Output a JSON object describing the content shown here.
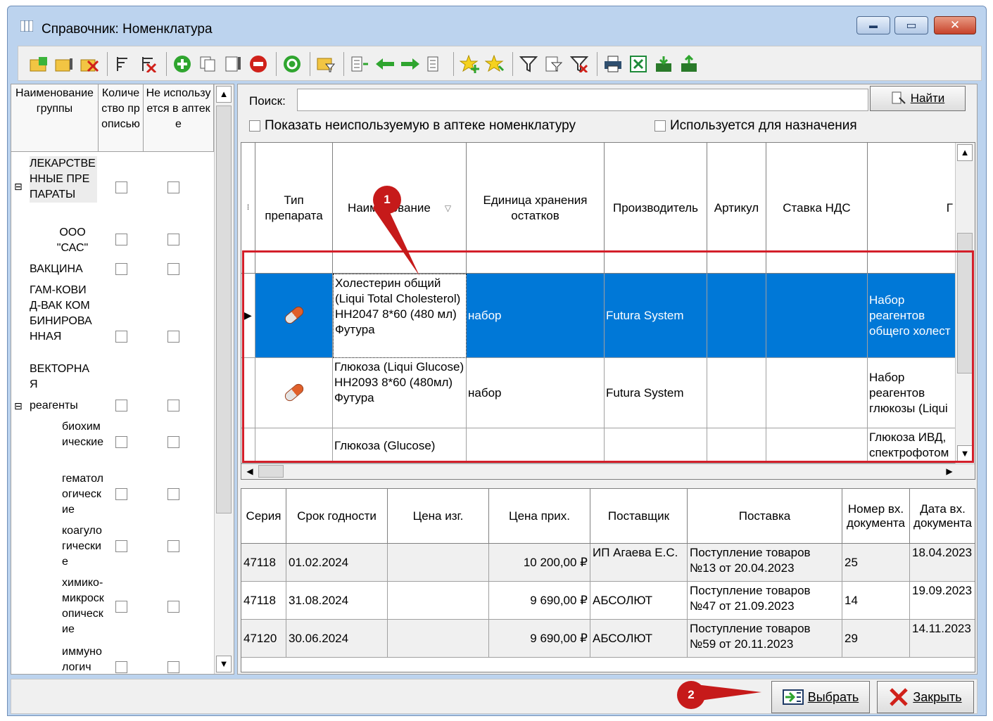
{
  "window": {
    "title": "Справочник: Номенклатура",
    "close_glyph": "✕",
    "min_glyph": "▬",
    "max_glyph": "▭"
  },
  "left_panel": {
    "headers": [
      "Наименование группы",
      "Количество прописью",
      "Не используется в аптеке"
    ],
    "tree": [
      {
        "label": "ЛЕКАРСТВЕННЫЕ ПРЕПАРАТЫ",
        "expand": "⊟"
      },
      {
        "label": "ООО \"САС\""
      },
      {
        "label": "ВАКЦИНА"
      },
      {
        "label": "ГАМ-КОВИД-ВАК КОМБИНИРОВАННАЯ"
      },
      {
        "label": "ВЕКТОРНАЯ"
      },
      {
        "label": "реагенты",
        "expand": "⊟"
      },
      {
        "label": "биохимические"
      },
      {
        "label": "гематологические"
      },
      {
        "label": "коагулогические"
      },
      {
        "label": "химико-микроскопические"
      },
      {
        "label": "иммунологич"
      }
    ]
  },
  "search": {
    "label": "Поиск:",
    "value": "",
    "find_button": "Найти",
    "checkbox_unused": "Показать неиспользуемую в аптеке номенклатуру",
    "checkbox_prescription": "Используется для назначения"
  },
  "grid": {
    "headers": [
      "Тип препарата",
      "Наименование",
      "Единица хранения остатков",
      "Производитель",
      "Артикул",
      "Ставка НДС",
      "Г"
    ],
    "rows": [
      {
        "name": "Холестерин общий (Liqui Total Cholesterol) НН2047 8*60 (480 мл) Футура",
        "unit": "набор",
        "maker": "Futura System",
        "article": "",
        "vat": "",
        "desc": "Набор реагентов общего холест"
      },
      {
        "name": "Глюкоза (Liqui Glucose) НН2093 8*60 (480мл) Футура",
        "unit": "набор",
        "maker": "Futura System",
        "article": "",
        "vat": "",
        "desc": "Набор реагентов глюкозы (Liqui"
      },
      {
        "name": "Глюкоза (Glucose)",
        "unit": "",
        "maker": "",
        "article": "",
        "vat": "",
        "desc": "Глюкоза ИВД, спектрофотом"
      }
    ]
  },
  "batches": {
    "headers": [
      "Серия",
      "Срок годности",
      "Цена изг.",
      "Цена прих.",
      "Поставщик",
      "Поставка",
      "Номер вх. документа",
      "Дата вх. документа"
    ],
    "rows": [
      {
        "series": "47118",
        "expiry": "01.02.2024",
        "price_mfr": "",
        "price_in": "10 200,00 ₽",
        "supplier": "ИП Агаева Е.С.",
        "delivery": "Поступление товаров №13 от 20.04.2023",
        "doc_num": "25",
        "doc_date": "18.04.2023"
      },
      {
        "series": "47118",
        "expiry": "31.08.2024",
        "price_mfr": "",
        "price_in": "9 690,00 ₽",
        "supplier": "АБСОЛЮТ",
        "delivery": "Поступление товаров №47 от 21.09.2023",
        "doc_num": "14",
        "doc_date": "19.09.2023"
      },
      {
        "series": "47120",
        "expiry": "30.06.2024",
        "price_mfr": "",
        "price_in": "9 690,00 ₽",
        "supplier": "АБСОЛЮТ",
        "delivery": "Поступление товаров №59 от 20.11.2023",
        "doc_num": "29",
        "doc_date": "14.11.2023"
      }
    ]
  },
  "footer": {
    "select_button": "Выбрать",
    "close_button": "Закрыть"
  },
  "annotations": {
    "marker1": "1",
    "marker2": "2"
  },
  "colors": {
    "selection": "#0078d7",
    "annotation": "#d31f2a"
  }
}
